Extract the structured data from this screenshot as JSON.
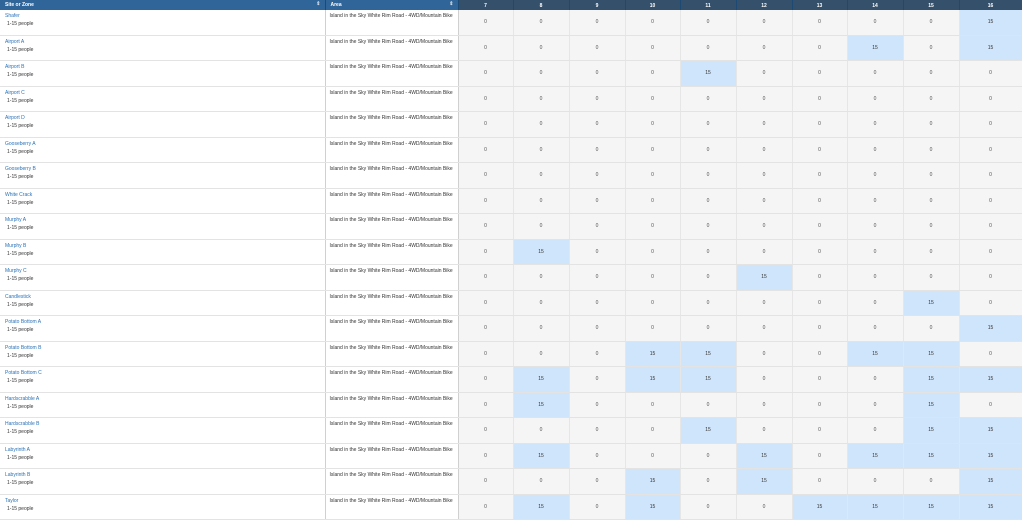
{
  "header": {
    "site_label": "Site or Zone",
    "area_label": "Area",
    "sort_icon": "sort-icon",
    "dates": [
      "7",
      "8",
      "9",
      "10",
      "11",
      "12",
      "13",
      "14",
      "15",
      "16"
    ]
  },
  "capacity_text": "1-15 people",
  "area_text": "Island in the Sky White Rim Road - 4WD/Mountain Bike",
  "colors": {
    "header_bg": "#2f6598",
    "link": "#2a72b8",
    "available_bg": "#cfe5fb",
    "unavailable_bg": "#f5f5f5"
  },
  "rows": [
    {
      "name": "Shafer",
      "values": [
        "0",
        "0",
        "0",
        "0",
        "0",
        "0",
        "0",
        "0",
        "0",
        "15"
      ]
    },
    {
      "name": "Airport A",
      "values": [
        "0",
        "0",
        "0",
        "0",
        "0",
        "0",
        "0",
        "15",
        "0",
        "15"
      ]
    },
    {
      "name": "Airport B",
      "values": [
        "0",
        "0",
        "0",
        "0",
        "15",
        "0",
        "0",
        "0",
        "0",
        "0"
      ]
    },
    {
      "name": "Airport C",
      "values": [
        "0",
        "0",
        "0",
        "0",
        "0",
        "0",
        "0",
        "0",
        "0",
        "0"
      ]
    },
    {
      "name": "Airport D",
      "values": [
        "0",
        "0",
        "0",
        "0",
        "0",
        "0",
        "0",
        "0",
        "0",
        "0"
      ]
    },
    {
      "name": "Gooseberry A",
      "values": [
        "0",
        "0",
        "0",
        "0",
        "0",
        "0",
        "0",
        "0",
        "0",
        "0"
      ]
    },
    {
      "name": "Gooseberry B",
      "values": [
        "0",
        "0",
        "0",
        "0",
        "0",
        "0",
        "0",
        "0",
        "0",
        "0"
      ]
    },
    {
      "name": "White Crack",
      "values": [
        "0",
        "0",
        "0",
        "0",
        "0",
        "0",
        "0",
        "0",
        "0",
        "0"
      ]
    },
    {
      "name": "Murphy A",
      "values": [
        "0",
        "0",
        "0",
        "0",
        "0",
        "0",
        "0",
        "0",
        "0",
        "0"
      ]
    },
    {
      "name": "Murphy B",
      "values": [
        "0",
        "15",
        "0",
        "0",
        "0",
        "0",
        "0",
        "0",
        "0",
        "0"
      ]
    },
    {
      "name": "Murphy C",
      "values": [
        "0",
        "0",
        "0",
        "0",
        "0",
        "15",
        "0",
        "0",
        "0",
        "0"
      ]
    },
    {
      "name": "Candlestick",
      "values": [
        "0",
        "0",
        "0",
        "0",
        "0",
        "0",
        "0",
        "0",
        "15",
        "0"
      ]
    },
    {
      "name": "Potato Bottom A",
      "values": [
        "0",
        "0",
        "0",
        "0",
        "0",
        "0",
        "0",
        "0",
        "0",
        "15"
      ]
    },
    {
      "name": "Potato Bottom B",
      "values": [
        "0",
        "0",
        "0",
        "15",
        "15",
        "0",
        "0",
        "15",
        "15",
        "0"
      ]
    },
    {
      "name": "Potato Bottom C",
      "values": [
        "0",
        "15",
        "0",
        "15",
        "15",
        "0",
        "0",
        "0",
        "15",
        "15"
      ]
    },
    {
      "name": "Hardscrabble A",
      "values": [
        "0",
        "15",
        "0",
        "0",
        "0",
        "0",
        "0",
        "0",
        "15",
        "0"
      ]
    },
    {
      "name": "Hardscrabble B",
      "values": [
        "0",
        "0",
        "0",
        "0",
        "15",
        "0",
        "0",
        "0",
        "15",
        "15"
      ]
    },
    {
      "name": "Labyrinth A",
      "values": [
        "0",
        "15",
        "0",
        "0",
        "0",
        "15",
        "0",
        "15",
        "15",
        "15"
      ]
    },
    {
      "name": "Labyrinth B",
      "values": [
        "0",
        "0",
        "0",
        "15",
        "0",
        "15",
        "0",
        "0",
        "0",
        "15"
      ]
    },
    {
      "name": "Taylor",
      "values": [
        "0",
        "15",
        "0",
        "15",
        "0",
        "0",
        "15",
        "15",
        "15",
        "15"
      ]
    }
  ]
}
